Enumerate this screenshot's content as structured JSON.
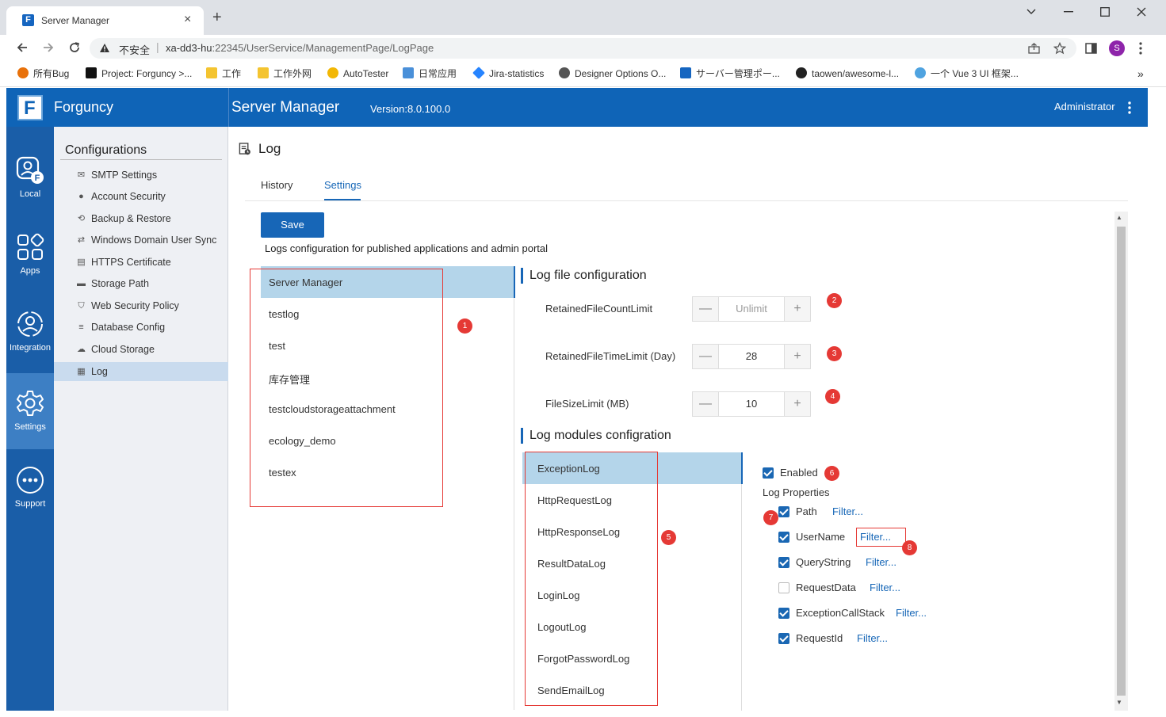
{
  "browser": {
    "tab_title": "Server Manager",
    "tab_close": "×",
    "new_tab": "+",
    "security_label": "不安全",
    "url_host": "xa-dd3-hu",
    "url_path": ":22345/UserService/ManagementPage/LogPage",
    "bookmarks": [
      "所有Bug",
      "Project: Forguncy >...",
      "工作",
      "工作外网",
      "AutoTester",
      "日常应用",
      "Jira-statistics",
      "Designer Options O...",
      "サーバー管理ポー...",
      "taowen/awesome-l...",
      "一个 Vue 3 UI 框架..."
    ],
    "bookmark_more": "»",
    "profile_initial": "S"
  },
  "header": {
    "brand": "Forguncy",
    "title": "Server Manager",
    "version": "Version:8.0.100.0",
    "user": "Administrator",
    "brand_color": "#0f64b7"
  },
  "nav": [
    {
      "label": "Local",
      "icon": "local-user-icon"
    },
    {
      "label": "Apps",
      "icon": "apps-grid-icon"
    },
    {
      "label": "Integration",
      "icon": "integration-icon"
    },
    {
      "label": "Settings",
      "icon": "settings-gear-icon"
    },
    {
      "label": "Support",
      "icon": "support-icon"
    }
  ],
  "config_sidebar": {
    "title": "Configurations",
    "items": [
      "SMTP Settings",
      "Account Security",
      "Backup & Restore",
      "Windows Domain User Sync",
      "HTTPS Certificate",
      "Storage Path",
      "Web Security Policy",
      "Database Config",
      "Cloud Storage",
      "Log"
    ]
  },
  "page": {
    "title": "Log",
    "tabs": [
      "History",
      "Settings"
    ],
    "save_label": "Save",
    "description": "Logs configuration for published applications and admin portal"
  },
  "apps": [
    "Server Manager",
    "testlog",
    "test",
    "库存管理",
    "testcloudstorageattachment",
    "ecology_demo",
    "testex"
  ],
  "log_file": {
    "heading": "Log file configuration",
    "fields": [
      {
        "label": "RetainedFileCountLimit",
        "value": "",
        "placeholder": "Unlimit"
      },
      {
        "label": "RetainedFileTimeLimit (Day)",
        "value": "28"
      },
      {
        "label": "FileSizeLimit (MB)",
        "value": "10"
      }
    ],
    "minus": "—",
    "plus": "+"
  },
  "log_modules": {
    "heading": "Log modules configration",
    "modules": [
      "ExceptionLog",
      "HttpRequestLog",
      "HttpResponseLog",
      "ResultDataLog",
      "LoginLog",
      "LogoutLog",
      "ForgotPasswordLog",
      "SendEmailLog"
    ],
    "enabled_label": "Enabled",
    "enabled": true,
    "properties_label": "Log Properties",
    "filter_label": "Filter...",
    "properties": [
      {
        "name": "Path",
        "checked": true
      },
      {
        "name": "UserName",
        "checked": true
      },
      {
        "name": "QueryString",
        "checked": true
      },
      {
        "name": "RequestData",
        "checked": false
      },
      {
        "name": "ExceptionCallStack",
        "checked": true
      },
      {
        "name": "RequestId",
        "checked": true
      }
    ]
  },
  "annotations": [
    "1",
    "2",
    "3",
    "4",
    "5",
    "6",
    "7",
    "8"
  ],
  "colors": {
    "accent": "#1766b7",
    "selected": "#b4d5ea",
    "annotation": "#e53935"
  }
}
